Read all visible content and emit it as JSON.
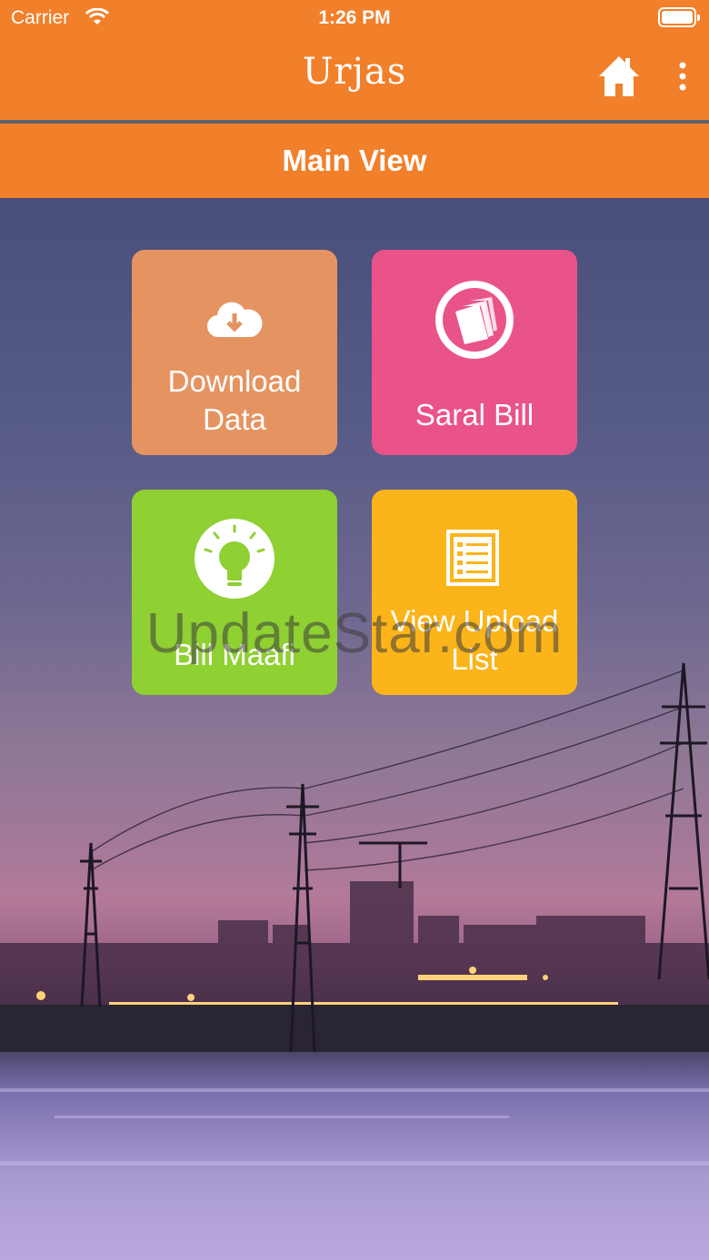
{
  "status_bar": {
    "carrier": "Carrier",
    "time": "1:26 PM"
  },
  "nav": {
    "brand": "Urjas",
    "home_icon": "home-icon",
    "menu_icon": "more-vertical-icon"
  },
  "title": "Main View",
  "tiles": [
    {
      "label_line1": "Download",
      "label_line2": "Data",
      "icon": "cloud-download-icon",
      "color": "#e59461"
    },
    {
      "label": "Saral Bill",
      "icon": "bill-papers-icon",
      "color": "#ea5389"
    },
    {
      "label": "Bill Maafi",
      "icon": "lightbulb-icon",
      "color": "#8fd032"
    },
    {
      "label_line1": "View Upload",
      "label_line2": "List",
      "icon": "list-document-icon",
      "color": "#fbb41a"
    }
  ],
  "watermark": "UpdateStar.com",
  "colors": {
    "primary": "#f27f2a",
    "divider": "#5d6470"
  }
}
